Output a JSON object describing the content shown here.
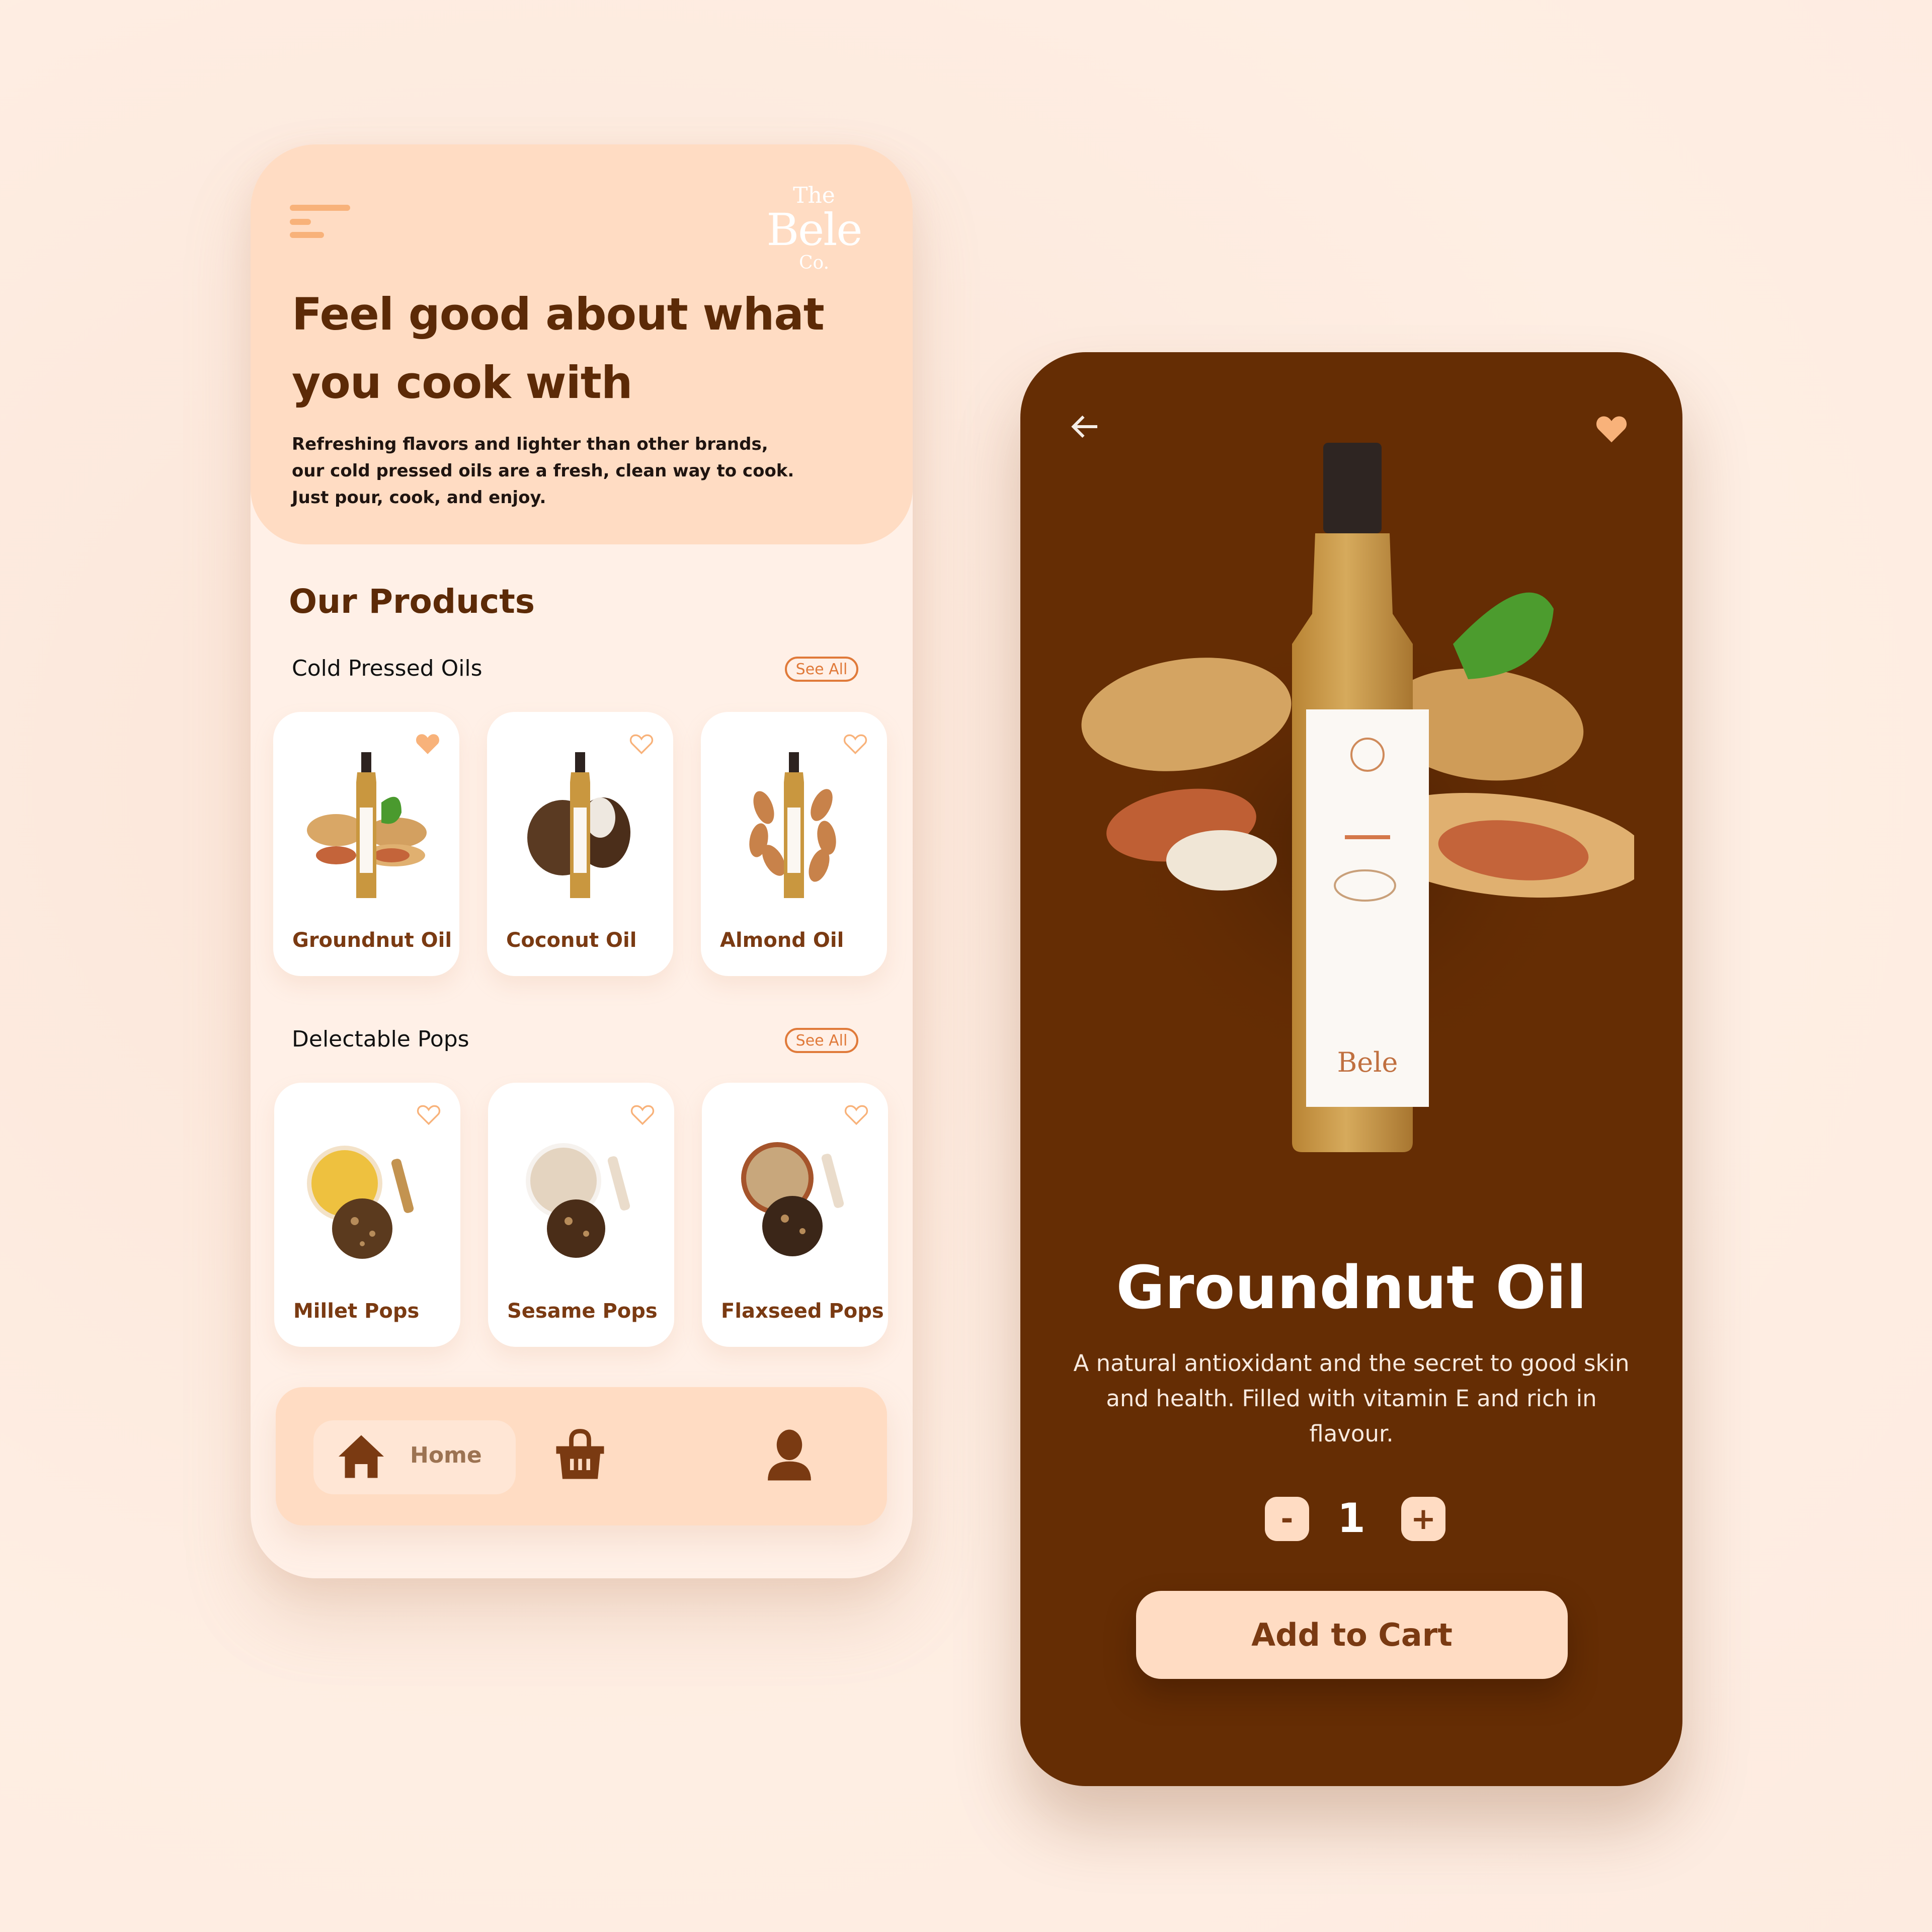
{
  "colors": {
    "background": "#fdeade",
    "hero_peach": "#ffdcc3",
    "dark_brown": "#652d04",
    "title_brown": "#5c2a07",
    "accent_orange": "#f8b27a",
    "see_all_orange": "#e07a3a"
  },
  "home_screen": {
    "brand": {
      "line1": "The",
      "line2": "Bele",
      "line3": "Co."
    },
    "hero": {
      "title": "Feel good about what you cook with",
      "text": "Refreshing flavors and lighter than other brands, our cold pressed oils are a fresh, clean way to cook. Just pour, cook, and enjoy."
    },
    "section_title": "Our Products",
    "categories": [
      {
        "title": "Cold Pressed Oils",
        "see_all_label": "See All",
        "products": [
          {
            "name": "Groundnut Oil",
            "favorite": true,
            "image": "groundnut-oil-bottle"
          },
          {
            "name": "Coconut Oil",
            "favorite": false,
            "image": "coconut-oil-bottle"
          },
          {
            "name": "Almond Oil",
            "favorite": false,
            "image": "almond-oil-bottle"
          }
        ]
      },
      {
        "title": "Delectable Pops",
        "see_all_label": "See All",
        "products": [
          {
            "name": "Millet Pops",
            "favorite": false,
            "image": "millet-pops"
          },
          {
            "name": "Sesame Pops",
            "favorite": false,
            "image": "sesame-pops"
          },
          {
            "name": "Flaxseed Pops",
            "favorite": false,
            "image": "flaxseed-pops"
          }
        ]
      }
    ],
    "bottom_nav": {
      "items": [
        {
          "label": "Home",
          "icon": "home-icon",
          "active": true
        },
        {
          "label": "",
          "icon": "basket-icon",
          "active": false
        },
        {
          "label": "",
          "icon": "user-icon",
          "active": false
        }
      ]
    }
  },
  "detail_screen": {
    "title": "Groundnut Oil",
    "description": "A natural antioxidant and the secret to good skin and health. Filled with vitamin E and rich in flavour.",
    "favorite": true,
    "quantity": "1",
    "minus_label": "-",
    "plus_label": "+",
    "add_to_cart_label": "Add to Cart"
  }
}
